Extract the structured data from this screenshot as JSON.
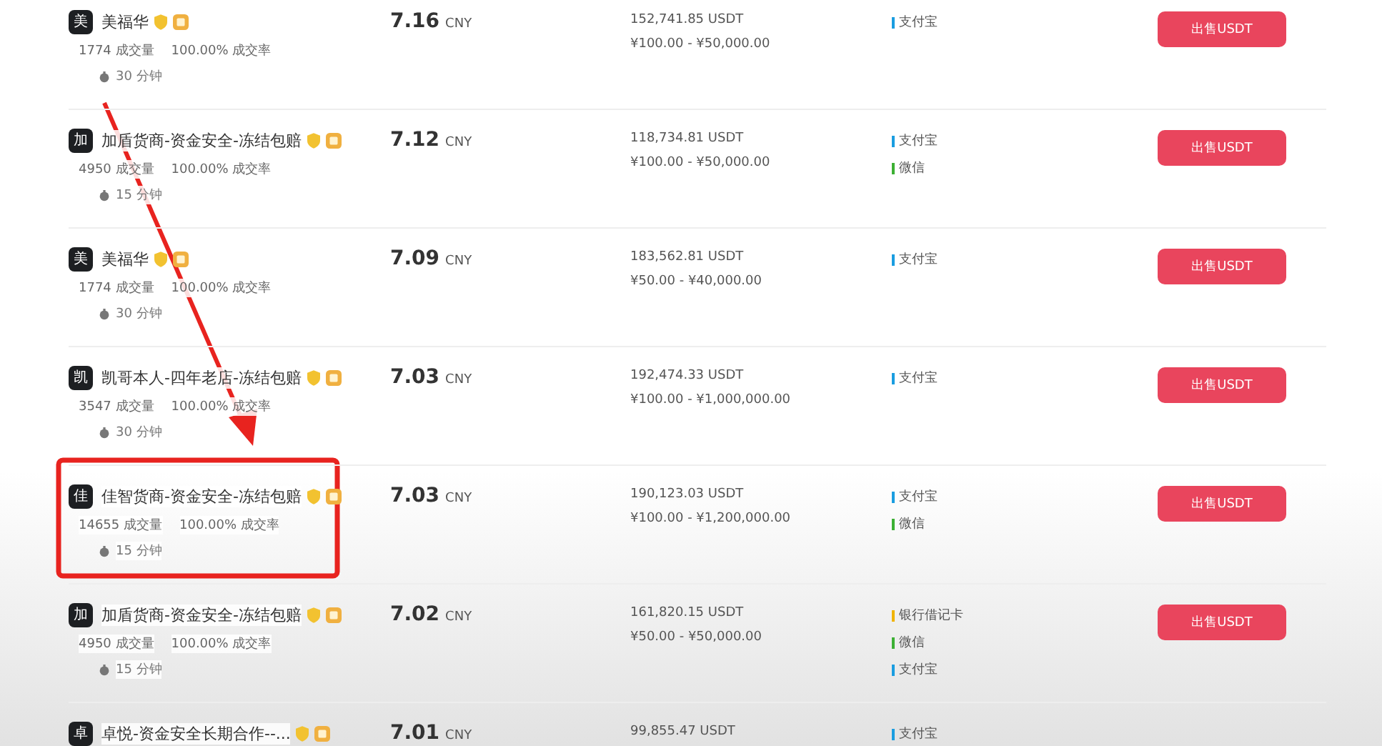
{
  "rows": [
    {
      "avatar": "美",
      "name": "美福华",
      "trades": "1774 成交量",
      "rate": "100.00% 成交率",
      "time": "30 分钟",
      "price": "7.16",
      "unit": "CNY",
      "available": "152,741.85 USDT",
      "limit": "¥100.00 - ¥50,000.00",
      "payments": [
        {
          "label": "支付宝",
          "color": "#1a9de0"
        }
      ],
      "button": "出售USDT"
    },
    {
      "avatar": "加",
      "name": "加盾货商-资金安全-冻结包赔",
      "trades": "4950 成交量",
      "rate": "100.00% 成交率",
      "time": "15 分钟",
      "price": "7.12",
      "unit": "CNY",
      "available": "118,734.81 USDT",
      "limit": "¥100.00 - ¥50,000.00",
      "payments": [
        {
          "label": "支付宝",
          "color": "#1a9de0"
        },
        {
          "label": "微信",
          "color": "#3cb034"
        }
      ],
      "button": "出售USDT"
    },
    {
      "avatar": "美",
      "name": "美福华",
      "trades": "1774 成交量",
      "rate": "100.00% 成交率",
      "time": "30 分钟",
      "price": "7.09",
      "unit": "CNY",
      "available": "183,562.81 USDT",
      "limit": "¥50.00 - ¥40,000.00",
      "payments": [
        {
          "label": "支付宝",
          "color": "#1a9de0"
        }
      ],
      "button": "出售USDT"
    },
    {
      "avatar": "凯",
      "name": "凯哥本人-四年老店-冻结包赔",
      "trades": "3547 成交量",
      "rate": "100.00% 成交率",
      "time": "30 分钟",
      "price": "7.03",
      "unit": "CNY",
      "available": "192,474.33 USDT",
      "limit": "¥100.00 - ¥1,000,000.00",
      "payments": [
        {
          "label": "支付宝",
          "color": "#1a9de0"
        }
      ],
      "button": "出售USDT"
    },
    {
      "avatar": "佳",
      "name": "佳智货商-资金安全-冻结包赔",
      "trades": "14655 成交量",
      "rate": "100.00% 成交率",
      "time": "15 分钟",
      "price": "7.03",
      "unit": "CNY",
      "available": "190,123.03 USDT",
      "limit": "¥100.00 - ¥1,200,000.00",
      "payments": [
        {
          "label": "支付宝",
          "color": "#1a9de0"
        },
        {
          "label": "微信",
          "color": "#3cb034"
        }
      ],
      "button": "出售USDT"
    },
    {
      "avatar": "加",
      "name": "加盾货商-资金安全-冻结包赔",
      "trades": "4950 成交量",
      "rate": "100.00% 成交率",
      "time": "15 分钟",
      "price": "7.02",
      "unit": "CNY",
      "available": "161,820.15 USDT",
      "limit": "¥50.00 - ¥50,000.00",
      "payments": [
        {
          "label": "银行借记卡",
          "color": "#f0b400"
        },
        {
          "label": "微信",
          "color": "#3cb034"
        },
        {
          "label": "支付宝",
          "color": "#1a9de0"
        }
      ],
      "button": "出售USDT"
    },
    {
      "avatar": "卓",
      "name": "卓悦-资金安全长期合作--...",
      "price": "7.01",
      "unit": "CNY",
      "available": "99,855.47 USDT",
      "payments": [
        {
          "label": "支付宝",
          "color": "#1a9de0"
        }
      ]
    }
  ]
}
